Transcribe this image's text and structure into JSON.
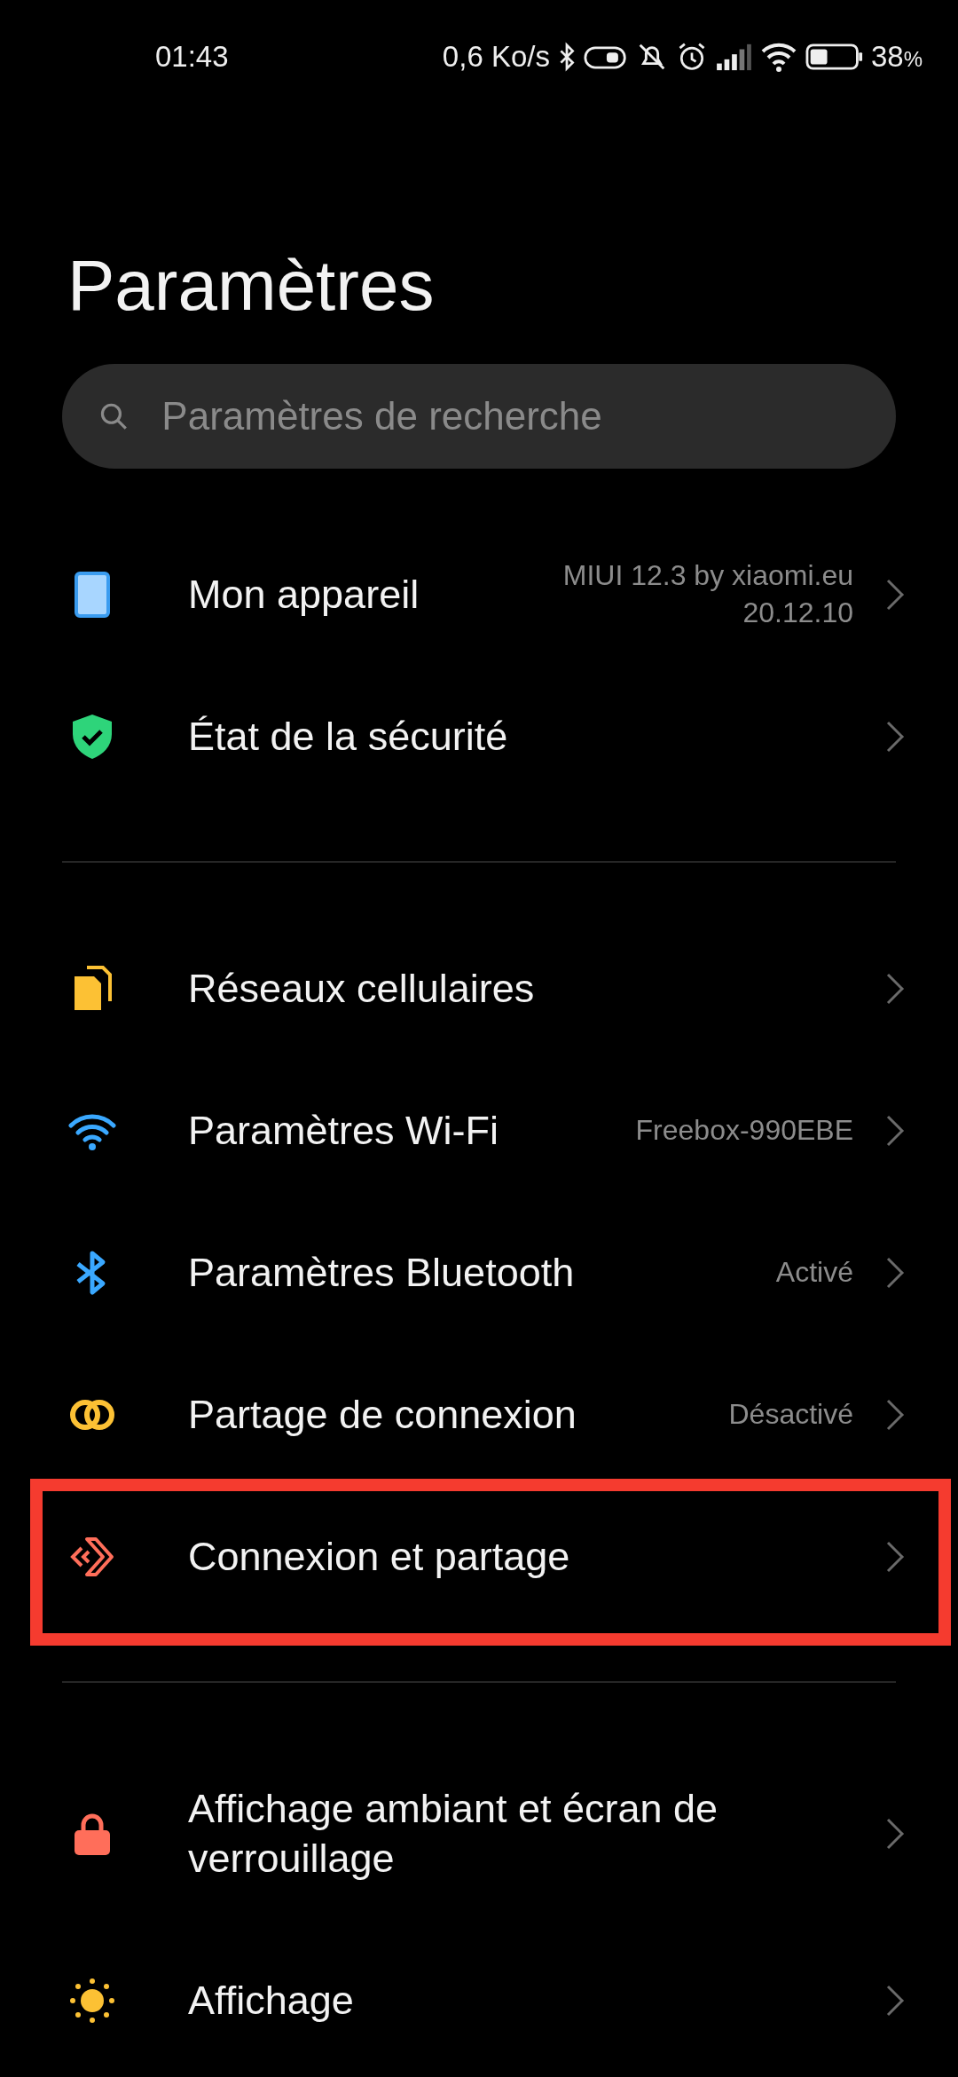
{
  "status_bar": {
    "time": "01:43",
    "speed": "0,6 Ko/s",
    "battery": "38",
    "battery_unit": "%"
  },
  "title": "Paramètres",
  "search": {
    "placeholder": "Paramètres de recherche"
  },
  "sections": [
    {
      "items": [
        {
          "label": "Mon appareil",
          "value": "MIUI 12.3 by xiaomi.eu\n20.12.10",
          "highlighted": false
        },
        {
          "label": "État de la sécurité",
          "highlighted": false
        }
      ]
    },
    {
      "items": [
        {
          "label": "Réseaux cellulaires",
          "highlighted": false
        },
        {
          "label": "Paramètres Wi-Fi",
          "value": "Freebox-990EBE",
          "highlighted": false
        },
        {
          "label": "Paramètres Bluetooth",
          "value": "Activé",
          "highlighted": false
        },
        {
          "label": "Partage de connexion",
          "value": "Désactivé",
          "highlighted": false
        },
        {
          "label": "Connexion et partage",
          "highlighted": true
        }
      ]
    },
    {
      "items": [
        {
          "label": "Affichage ambiant et écran de verrouillage",
          "highlighted": false
        },
        {
          "label": "Affichage",
          "highlighted": false
        }
      ]
    }
  ]
}
